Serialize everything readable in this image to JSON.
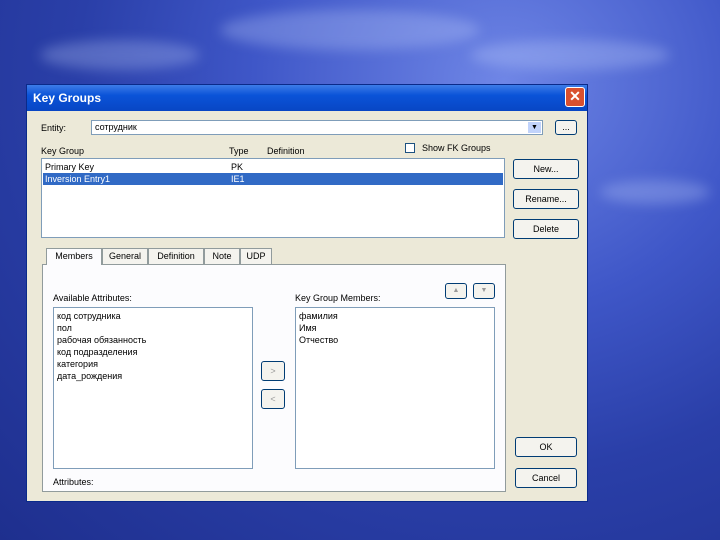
{
  "dialog": {
    "title": "Key Groups",
    "close_glyph": "✕",
    "entity_label": "Entity:",
    "entity_value": "сотрудник",
    "dropdown_glyph": "▼",
    "browse_label": "...",
    "columns": {
      "key_group": "Key Group",
      "type": "Type",
      "definition": "Definition"
    },
    "show_fk_groups_label": "Show FK Groups",
    "key_groups": [
      {
        "name": "Primary Key",
        "type": "PK",
        "selected": false
      },
      {
        "name": "Inversion Entry1",
        "type": "IE1",
        "selected": true
      }
    ],
    "buttons": {
      "new": "New...",
      "rename": "Rename...",
      "delete": "Delete",
      "ok": "OK",
      "cancel": "Cancel"
    },
    "tabs": [
      "Members",
      "General",
      "Definition",
      "Note",
      "UDP"
    ],
    "members": {
      "available_label": "Available Attributes:",
      "available": [
        "код сотрудника",
        "пол",
        "рабочая обязанность",
        "код подразделения",
        "категория",
        "дата_рождения"
      ],
      "group_label": "Key Group Members:",
      "group_members": [
        "фамилия",
        "Имя",
        "Отчество"
      ],
      "move_right_glyph": ">",
      "move_left_glyph": "<",
      "move_up_glyph": "▲",
      "move_down_glyph": "▼",
      "attributes_label": "Attributes:"
    }
  },
  "colors": {
    "accent": "#0a53d8",
    "selection": "#316ac5",
    "dialog_bg": "#ece9d8",
    "desktop": "#2a3fa8"
  }
}
